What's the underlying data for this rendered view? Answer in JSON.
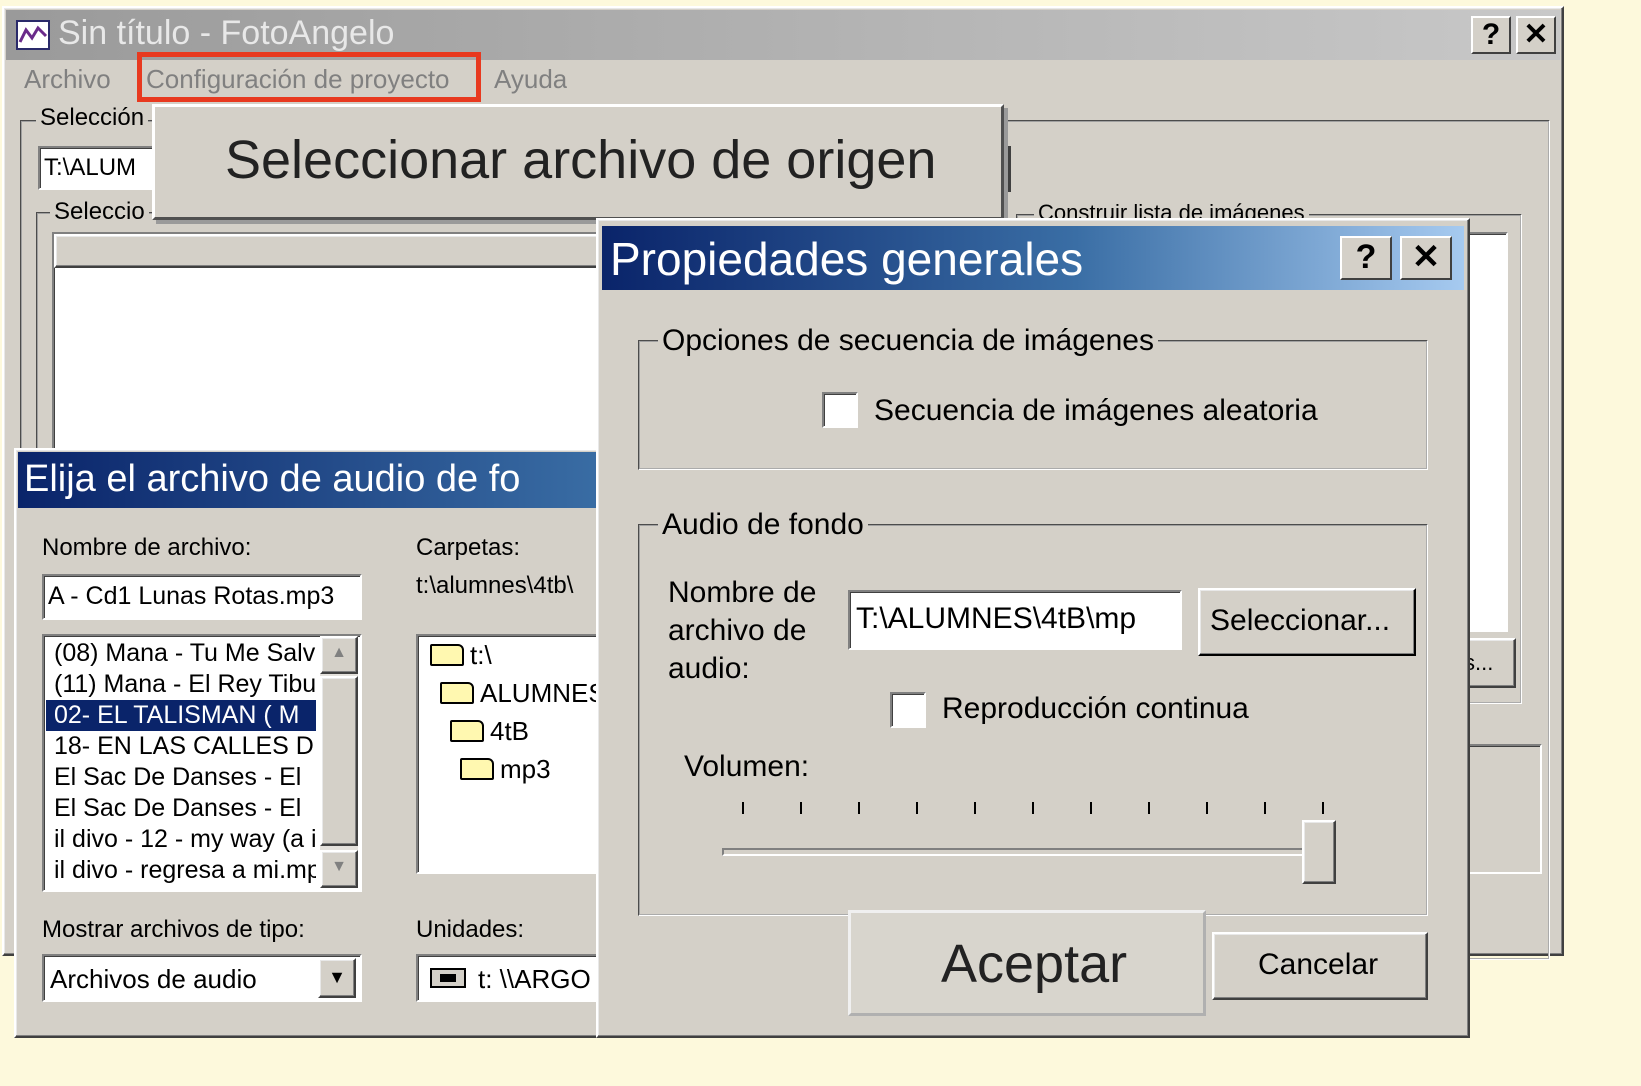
{
  "main_window": {
    "title": "Sin título - FotoAngelo",
    "menu": [
      "Archivo",
      "Configuración de proyecto",
      "Ayuda"
    ],
    "highlight_color": "#e8391f",
    "selection_label_1": "Selección",
    "path_value": "T:\\ALUM",
    "selection_label_2": "Seleccio",
    "build_list_label": "Construir lista de imágenes",
    "partial_button": "s...",
    "help_icon": "question-icon",
    "close_icon": "close-icon"
  },
  "callout": {
    "label": "Seleccionar archivo de origen"
  },
  "audio_dialog": {
    "title": "Elija el archivo de audio de fo",
    "filename_label": "Nombre de archivo:",
    "filename_value": "A - Cd1  Lunas Rotas.mp3",
    "files": [
      "(08) Mana - Tu Me Salv",
      "(11) Mana - El Rey Tibu",
      "02- EL TALISMAN  ( M",
      "18- EN LAS CALLES D",
      "El Sac De Danses - El",
      "El Sac De Danses - El",
      "il divo - 12 - my way (a i",
      "il divo - regresa a mi.mp"
    ],
    "selected_index": 2,
    "folders_label": "Carpetas:",
    "folders_path": "t:\\alumnes\\4tb\\",
    "folders": [
      "t:\\",
      "ALUMNES",
      "4tB",
      "mp3"
    ],
    "filetype_label": "Mostrar archivos de tipo:",
    "filetype_value": "Archivos de audio",
    "drives_label": "Unidades:",
    "drive_value": "t: \\\\ARGO",
    "title_color": "#0a246a"
  },
  "props_dialog": {
    "title": "Propiedades generales",
    "seq_group": "Opciones de secuencia de imágenes",
    "random_label": "Secuencia de imágenes aleatoria",
    "random_checked": false,
    "audio_group": "Audio de fondo",
    "audio_name_label_1": "Nombre de",
    "audio_name_label_2": "archivo de",
    "audio_name_label_3": "audio:",
    "audio_path": "T:\\ALUMNES\\4tB\\mp",
    "select_button": "Seleccionar...",
    "continuous_label": "Reproducción continua",
    "continuous_checked": false,
    "volume_label": "Volumen:",
    "volume_level": 1.0,
    "ok_button": "Aceptar",
    "cancel_button": "Cancelar",
    "help_icon": "question-icon",
    "close_icon": "close-icon"
  }
}
